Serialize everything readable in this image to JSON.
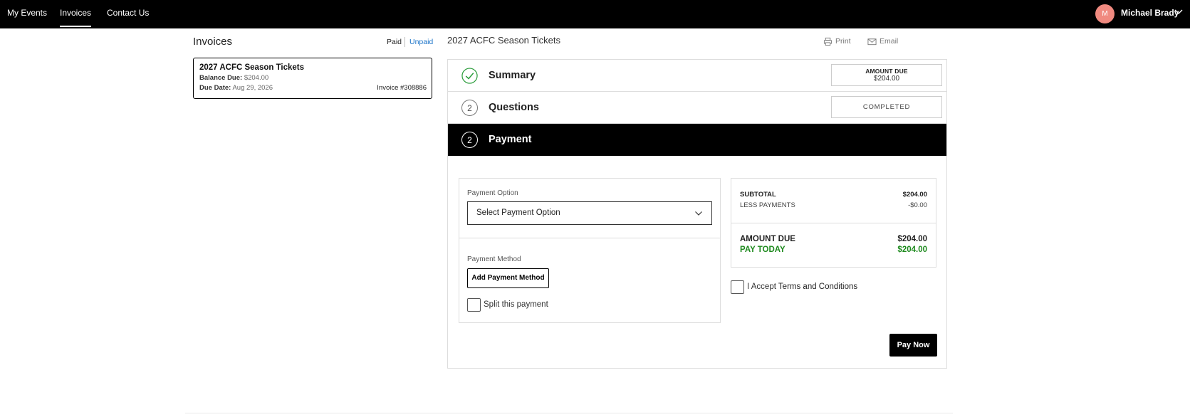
{
  "nav": {
    "links": [
      "My Events",
      "Invoices",
      "Contact Us"
    ],
    "active_index": 1,
    "user": {
      "initial": "M",
      "name": "Michael Brady"
    }
  },
  "sidebar": {
    "heading": "Invoices",
    "filters": {
      "paid": "Paid",
      "unpaid": "Unpaid"
    },
    "invoice": {
      "title": "2027 ACFC Season Tickets",
      "balance_label": "Balance Due:",
      "balance_value": "$204.00",
      "due_label": "Due Date:",
      "due_value": "Aug 29, 2026",
      "invoice_number": "Invoice #308886"
    }
  },
  "main": {
    "title": "2027 ACFC Season Tickets",
    "actions": {
      "print": "Print",
      "email": "Email"
    },
    "steps": {
      "summary": {
        "title": "Summary",
        "box_label": "AMOUNT DUE",
        "box_value": "$204.00"
      },
      "questions": {
        "number": "2",
        "title": "Questions",
        "status": "COMPLETED"
      },
      "payment": {
        "number": "2",
        "title": "Payment"
      }
    },
    "payment": {
      "option_label": "Payment Option",
      "option_value": "Select Payment Option",
      "method_label": "Payment Method",
      "add_method": "Add Payment Method",
      "split_label": "Split this payment"
    },
    "totals": {
      "subtotal_label": "SUBTOTAL",
      "subtotal_value": "$204.00",
      "less_label": "LESS PAYMENTS",
      "less_value": "-$0.00",
      "amount_due_label": "AMOUNT DUE",
      "amount_due_value": "$204.00",
      "pay_today_label": "PAY TODAY",
      "pay_today_value": "$204.00"
    },
    "terms": {
      "prefix": "I Accept",
      "link": "Terms and Conditions"
    },
    "pay_now": "Pay Now"
  },
  "colors": {
    "accent_link": "#1a73c8",
    "pay_today": "#1e8a1e",
    "avatar": "#f08a80"
  }
}
